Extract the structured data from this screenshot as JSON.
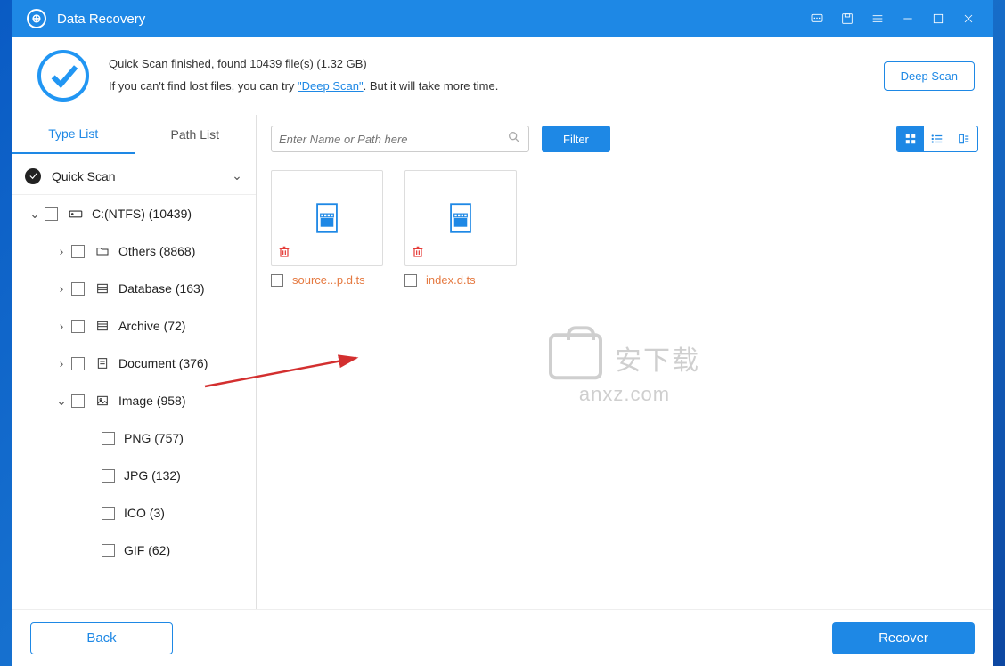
{
  "app": {
    "title": "Data Recovery"
  },
  "banner": {
    "line1": "Quick Scan finished, found 10439 file(s) (1.32 GB)",
    "line2a": "If you can't find lost files, you can try ",
    "link": "\"Deep Scan\"",
    "line2b": ". But it will take more time.",
    "deepscan_btn": "Deep Scan"
  },
  "sidebar": {
    "tabs": {
      "type": "Type List",
      "path": "Path List"
    },
    "root": "Quick Scan",
    "drive": "C:(NTFS) (10439)",
    "items": [
      {
        "label": "Others (8868)",
        "icon": "folder"
      },
      {
        "label": "Database (163)",
        "icon": "db"
      },
      {
        "label": "Archive (72)",
        "icon": "archive"
      },
      {
        "label": "Document (376)",
        "icon": "doc"
      },
      {
        "label": "Image (958)",
        "icon": "image",
        "expanded": true
      }
    ],
    "image_children": [
      {
        "label": "PNG (757)"
      },
      {
        "label": "JPG (132)"
      },
      {
        "label": "ICO (3)"
      },
      {
        "label": "GIF (62)"
      }
    ]
  },
  "toolbar": {
    "search_placeholder": "Enter Name or Path here",
    "filter": "Filter"
  },
  "files": [
    {
      "name": "source...p.d.ts"
    },
    {
      "name": "index.d.ts"
    }
  ],
  "footer": {
    "back": "Back",
    "recover": "Recover"
  },
  "watermark": {
    "cn": "安下载",
    "en": "anxz.com"
  }
}
